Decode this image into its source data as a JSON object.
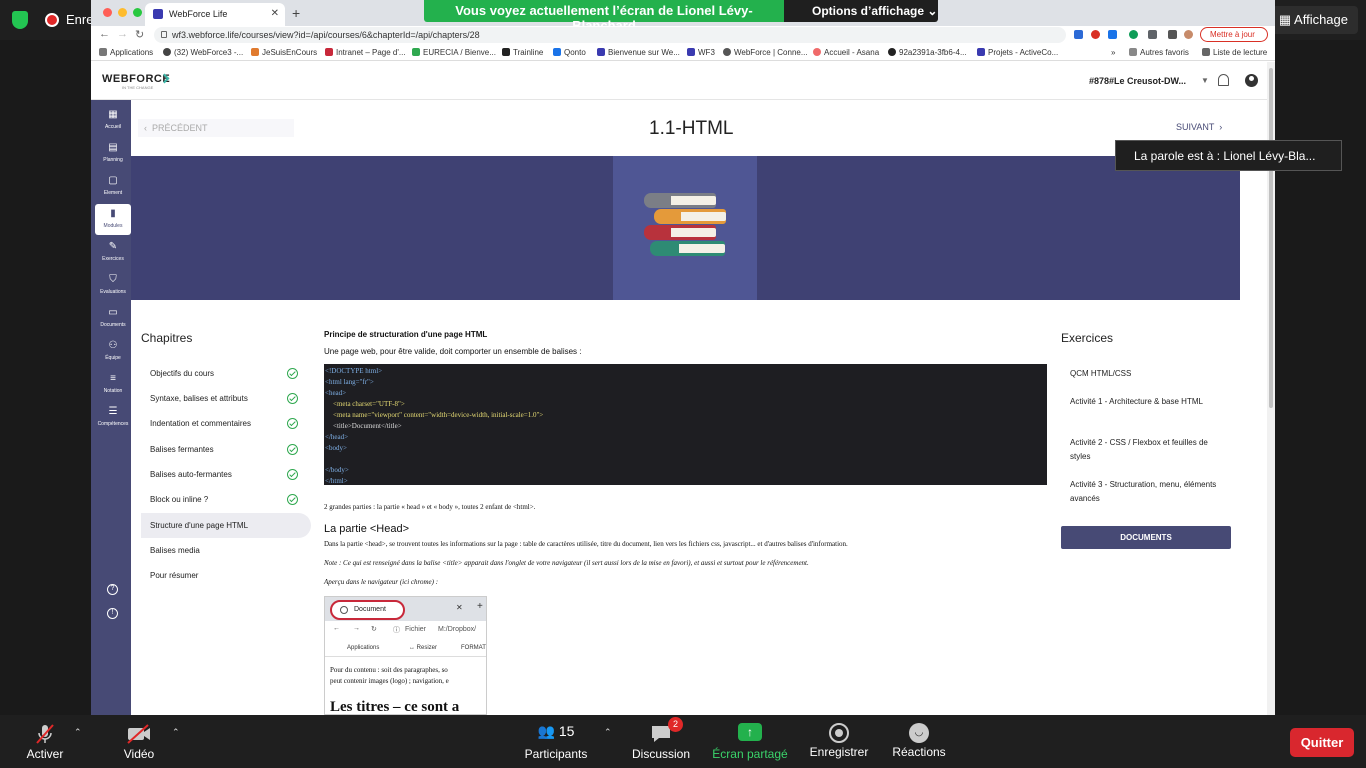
{
  "zoom_top": {
    "recording_label": "Enregistrement",
    "display_label": "Affichage"
  },
  "browser": {
    "tab_title": "WebForce Life",
    "url": "wf3.webforce.life/courses/view?id=/api/courses/6&chapterId=/api/chapters/28",
    "update_label": "Mettre à jour",
    "bookmarks": [
      "Applications",
      "(32) WebForce3 -...",
      "JeSuisEnCours",
      "Intranet – Page d'...",
      "EURECIA / Bienve...",
      "Trainline",
      "Qonto",
      "Bienvenue sur We...",
      "WF3",
      "WebForce | Conne...",
      "Accueil - Asana",
      "92a2391a-3fb6-4...",
      "Projets - ActiveCo...",
      "»",
      "Autres favoris",
      "Liste de lecture"
    ]
  },
  "share": {
    "banner": "Vous voyez actuellement l’écran de Lionel Lévy-Blanchard",
    "options": "Options d’affichage"
  },
  "site": {
    "logo": "WEBFORCE",
    "logo_sub": "IN THE CHANGE",
    "promo": "#878#Le Creusot-DW..."
  },
  "sidebar": [
    {
      "glyph": "▦",
      "label": "Accueil"
    },
    {
      "glyph": "▤",
      "label": "Planning"
    },
    {
      "glyph": "▢",
      "label": "Element"
    },
    {
      "glyph": "▮",
      "label": "Modules",
      "active": true
    },
    {
      "glyph": "✎",
      "label": "Exercices"
    },
    {
      "glyph": "⛉",
      "label": "Evaluations"
    },
    {
      "glyph": "▭",
      "label": "Documents"
    },
    {
      "glyph": "⚇",
      "label": "Équipe"
    },
    {
      "glyph": "≡",
      "label": "Notation"
    },
    {
      "glyph": "☰",
      "label": "Compétences"
    }
  ],
  "course": {
    "prev": "PRÉCÉDENT",
    "title": "1.1-HTML",
    "next": "SUIVANT"
  },
  "chapters": {
    "title": "Chapitres",
    "items": [
      {
        "label": "Objectifs du cours",
        "done": true
      },
      {
        "label": "Syntaxe, balises et attributs",
        "done": true
      },
      {
        "label": "Indentation et commentaires",
        "done": true
      },
      {
        "label": "Balises fermantes",
        "done": true
      },
      {
        "label": "Balises auto-fermantes",
        "done": true
      },
      {
        "label": "Block ou inline ?",
        "done": true
      },
      {
        "label": "Structure d'une page HTML",
        "done": false,
        "active": true
      },
      {
        "label": "Balises media",
        "done": false
      },
      {
        "label": "Pour résumer",
        "done": false
      }
    ]
  },
  "content": {
    "heading": "Principe de structuration d'une page HTML",
    "intro": "Une page web, pour être valide, doit comporter un ensemble de balises :",
    "code": {
      "doctype": "<!DOCTYPE html>",
      "html_open": "<html lang=\"fr\">",
      "head_open": "<head>",
      "meta_charset": "<meta charset=\"UTF-8\">",
      "meta_viewport": "<meta name=\"viewport\" content=\"width=device-width, initial-scale=1.0\">",
      "title_line": "<title>Document</title>",
      "head_close": "</head>",
      "body_open": "<body>",
      "body_close": "</body>",
      "html_close": "</html>"
    },
    "para1": "2 grandes parties : la partie « head » et « body », toutes 2 enfant de <html>.",
    "head_title": "La partie <Head>",
    "para2": "Dans la partie <head>, se trouvent toutes les informations sur la page : table de caractères utilisée, titre du document,  lien vers les fichiers css, javascript... et d'autres balises d'information.",
    "note": "Note : Ce qui est renseigné dans la balise <title> apparait dans l'onglet de votre navigateur  (il sert aussi lors de la mise en favori), et aussi et surtout pour le référencement.",
    "apercu": "Aperçu dans le navigateur (ici chrome) :",
    "mini": {
      "tab": "Document",
      "addr_label": "Fichier",
      "addr_path": "M:/Dropbox/",
      "bm1": "Applications",
      "bm2": "↔ Resizer",
      "bm3": "FORMAT",
      "text1": "Pour du contenu : soit des paragraphes, so",
      "text2": "peut contenir images (logo) ; navigation, e",
      "heading": "Les titres – ce sont a"
    }
  },
  "exercises": {
    "title": "Exercices",
    "items": [
      "QCM HTML/CSS",
      "Activité 1 - Architecture & base HTML",
      "Activité 2 - CSS / Flexbox et feuilles de styles",
      "Activité 3 - Structuration, menu, éléments avancés"
    ],
    "docs_button": "DOCUMENTS"
  },
  "speaker": "La parole est à : Lionel Lévy-Bla...",
  "zoom_bottom": {
    "mute": "Activer",
    "video": "Vidéo",
    "participants": "Participants",
    "participants_count": "15",
    "chat": "Discussion",
    "chat_badge": "2",
    "share": "Écran partagé",
    "record": "Enregistrer",
    "reactions": "Réactions",
    "quit": "Quitter"
  },
  "colors": {
    "brand": "#474a75",
    "share_green": "#23b14d",
    "quit_red": "#d9272e",
    "check_green": "#2fa84f"
  }
}
